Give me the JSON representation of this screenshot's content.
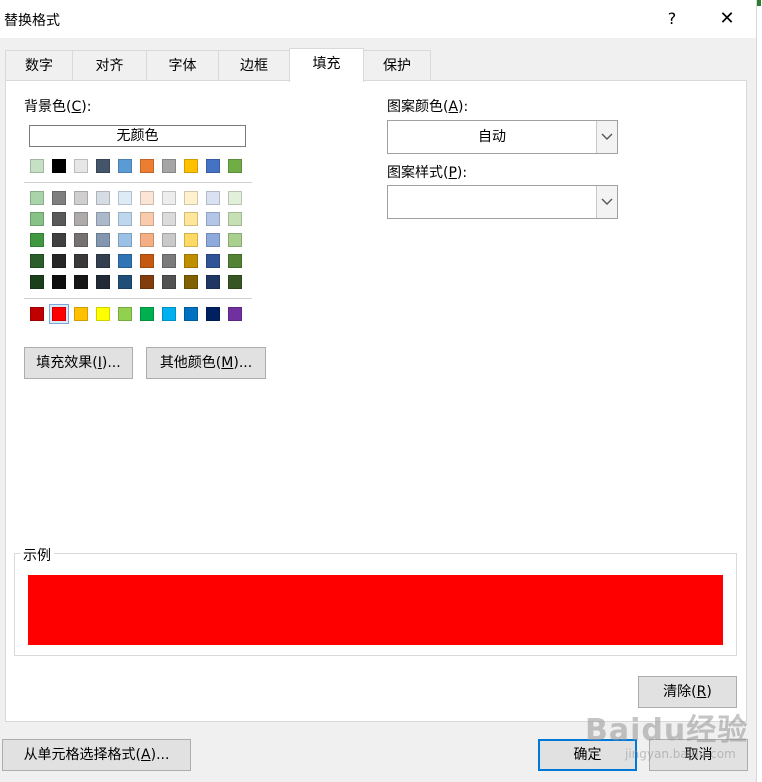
{
  "dialog": {
    "title": "替换格式",
    "help": "?",
    "close": "✕"
  },
  "tabs": [
    {
      "label": "数字"
    },
    {
      "label": "对齐"
    },
    {
      "label": "字体"
    },
    {
      "label": "边框"
    },
    {
      "label": "填充",
      "active": true
    },
    {
      "label": "保护"
    }
  ],
  "background": {
    "label_pre": "背景色(",
    "label_key": "C",
    "label_post": "):",
    "no_color": "无颜色",
    "theme_top_row": [
      "#c6e0c6",
      "#000000",
      "#e7e6e6",
      "#44546a",
      "#5b9bd5",
      "#ed7d31",
      "#a5a5a5",
      "#ffc000",
      "#4472c4",
      "#70ad47"
    ],
    "theme_shades": [
      [
        "#a9d3a9",
        "#7f7f7f",
        "#d0cece",
        "#d6dce4",
        "#ddebf7",
        "#fce4d6",
        "#ededed",
        "#fff2cc",
        "#d9e1f2",
        "#e2efda"
      ],
      [
        "#86c286",
        "#595959",
        "#aeaaaa",
        "#acb9ca",
        "#bdd7ee",
        "#f8cbad",
        "#dbdbdb",
        "#ffe699",
        "#b4c6e7",
        "#c6e0b4"
      ],
      [
        "#409940",
        "#404040",
        "#757171",
        "#8497b0",
        "#9bc2e6",
        "#f4b084",
        "#c9c9c9",
        "#ffd966",
        "#8ea9db",
        "#a9d08e"
      ],
      [
        "#2a5d2a",
        "#262626",
        "#3a3838",
        "#333f4f",
        "#2f75b5",
        "#c65911",
        "#7b7b7b",
        "#bf8f00",
        "#305496",
        "#548235"
      ],
      [
        "#1b3e1b",
        "#0d0d0d",
        "#161616",
        "#222b35",
        "#1f4e78",
        "#833c0c",
        "#525252",
        "#806000",
        "#203764",
        "#375623"
      ]
    ],
    "standard_colors": [
      "#c00000",
      "#ff0000",
      "#ffc000",
      "#ffff00",
      "#92d050",
      "#00b050",
      "#00b0f0",
      "#0070c0",
      "#002060",
      "#7030a0"
    ],
    "selected_color": "#ff0000"
  },
  "buttons": {
    "fill_effects_pre": "填充效果(",
    "fill_effects_key": "I",
    "fill_effects_post": ")...",
    "more_colors_pre": "其他颜色(",
    "more_colors_key": "M",
    "more_colors_post": ")...",
    "clear_pre": "清除(",
    "clear_key": "R",
    "clear_post": ")",
    "choose_from_cell_pre": "从单元格选择格式(",
    "choose_from_cell_key": "A",
    "choose_from_cell_post": ")...",
    "ok": "确定",
    "cancel": "取消"
  },
  "pattern": {
    "color_label_pre": "图案颜色(",
    "color_label_key": "A",
    "color_label_post": "):",
    "color_value": "自动",
    "style_label_pre": "图案样式(",
    "style_label_key": "P",
    "style_label_post": "):",
    "style_value": ""
  },
  "sample": {
    "label": "示例",
    "color": "#ff0000"
  },
  "watermark": {
    "main": "Baidu经验",
    "sub": "jingyan.baidu.com"
  }
}
